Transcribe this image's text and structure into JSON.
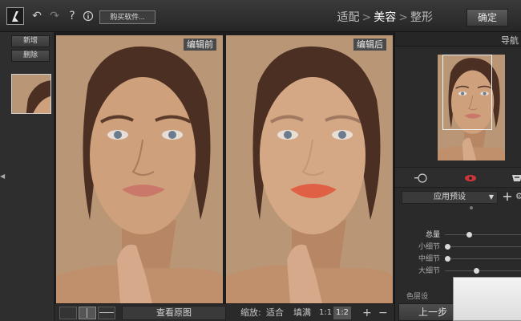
{
  "toolbar": {
    "buy_label": "购买软件...",
    "icons": [
      "undo-icon",
      "redo-icon",
      "help-icon",
      "info-icon"
    ]
  },
  "steps": {
    "items": [
      "适配",
      "美容",
      "整形"
    ],
    "active_index": 1,
    "separator": ">"
  },
  "confirm_label": "确定",
  "left_panel": {
    "new_label": "新增",
    "delete_label": "删除"
  },
  "canvas": {
    "before_label": "编辑前",
    "after_label": "编辑后"
  },
  "bottom_bar": {
    "view_original_label": "查看原图",
    "zoom_label": "缩放:",
    "fit_label": "适合",
    "fill_label": "填满",
    "ratio_11": "1:1",
    "ratio_12": "1:2",
    "zoom_in": "+",
    "zoom_out": "−"
  },
  "right_panel": {
    "navigator_title": "导航",
    "preset_label": "应用预设",
    "preset_add": "+",
    "sliders": [
      {
        "label": "总量",
        "value": 0.3
      },
      {
        "label": "小细节",
        "value": 0.0
      },
      {
        "label": "中细节",
        "value": 0.0
      },
      {
        "label": "大细节",
        "value": 0.4
      }
    ],
    "layer_label": "色层设",
    "prev_label": "上一步"
  },
  "colors": {
    "background": "#2b2b2b",
    "accent_eye": "#d2343c",
    "skin": "#c69a78",
    "backdrop": "#b99676"
  }
}
